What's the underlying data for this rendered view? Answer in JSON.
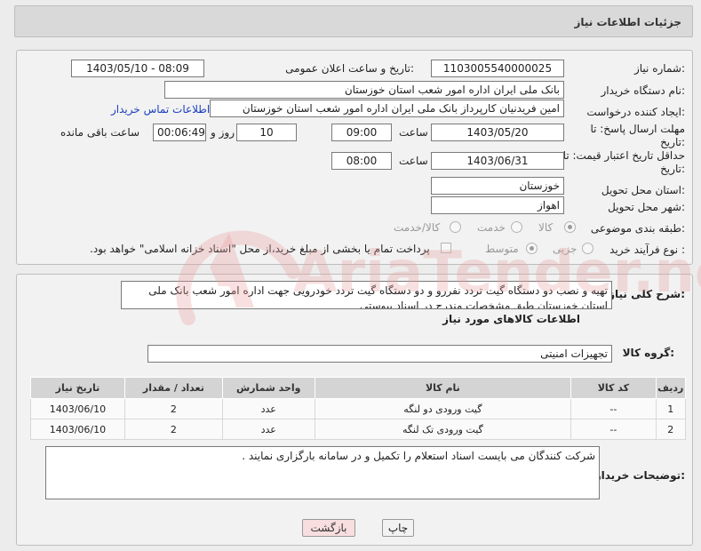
{
  "header": {
    "title": "جزئیات اطلاعات نیاز"
  },
  "form": {
    "need_number_label": "شماره نیاز:",
    "need_number": "1103005540000025",
    "announce_label": "تاریخ و ساعت اعلان عمومی:",
    "announce_value": "1403/05/10 - 08:09",
    "buyer_org_label": "نام دستگاه خریدار:",
    "buyer_org": "بانک ملی ایران اداره امور شعب استان خوزستان",
    "creator_label": "ایجاد کننده درخواست:",
    "creator": "امین  فریدنیان  کارپرداز بانک ملی ایران اداره امور شعب استان خوزستان",
    "contact_link": "اطلاعات تماس خریدار",
    "reply_deadline_label_1": "مهلت ارسال پاسخ: تا",
    "reply_deadline_label_2": "تاریخ:",
    "reply_date": "1403/05/20",
    "time_label": "ساعت",
    "reply_time": "09:00",
    "days_value": "10",
    "days_label": "روز و",
    "remaining_value": "00:06:49",
    "remaining_label": "ساعت باقی مانده",
    "validity_label_1": "حداقل تاریخ اعتبار قیمت: تا",
    "validity_label_2": "تاریخ:",
    "validity_date": "1403/06/31",
    "validity_time": "08:00",
    "province_label": "استان محل تحویل:",
    "province": "خوزستان",
    "city_label": "شهر محل تحویل:",
    "city": "اهواز",
    "category_label": "طبقه بندی موضوعی:",
    "category_options": [
      "کالا",
      "خدمت",
      "کالا/خدمت"
    ],
    "process_label": "نوع فرآیند خرید :",
    "process_options": [
      "جزیی",
      "متوسط"
    ],
    "payment_note": "پرداخت تمام یا بخشی از مبلغ خرید،از محل \"اسناد خزانه اسلامی\" خواهد بود."
  },
  "details": {
    "description_label": "شرح کلی نیاز:",
    "description": "تهیه و نصب دو دستگاه گیت تردد نفررو و دو دستگاه گیت تردد خودرویی جهت اداره امور شعب بانک ملی استان خوزستان طبق مشخصات مندرج در اسناد پیوستی",
    "goods_info_title": "اطلاعات کالاهای مورد نیاز",
    "group_label": "گروه کالا:",
    "group_value": "تجهیزات امنیتی",
    "table": {
      "headers": [
        "ردیف",
        "کد کالا",
        "نام کالا",
        "واحد شمارش",
        "تعداد / مقدار",
        "تاریخ نیاز"
      ],
      "rows": [
        [
          "1",
          "--",
          "گیت ورودی دو لنگه",
          "عدد",
          "2",
          "1403/06/10"
        ],
        [
          "2",
          "--",
          "گیت ورودی تک لنگه",
          "عدد",
          "2",
          "1403/06/10"
        ]
      ]
    },
    "buyer_notes_label": "توضیحات خریدار:",
    "buyer_notes": "شرکت کنندگان می بایست اسناد استعلام را تکمیل و در سامانه بارگزاری نمایند ."
  },
  "buttons": {
    "print": "چاپ",
    "back": "بازگشت"
  },
  "watermark": {
    "text": "AriaTender.neT"
  },
  "colors": {
    "link": "#1a3fbf",
    "back_button_bg": "#f8dede",
    "watermark": "#e8a0a0"
  }
}
